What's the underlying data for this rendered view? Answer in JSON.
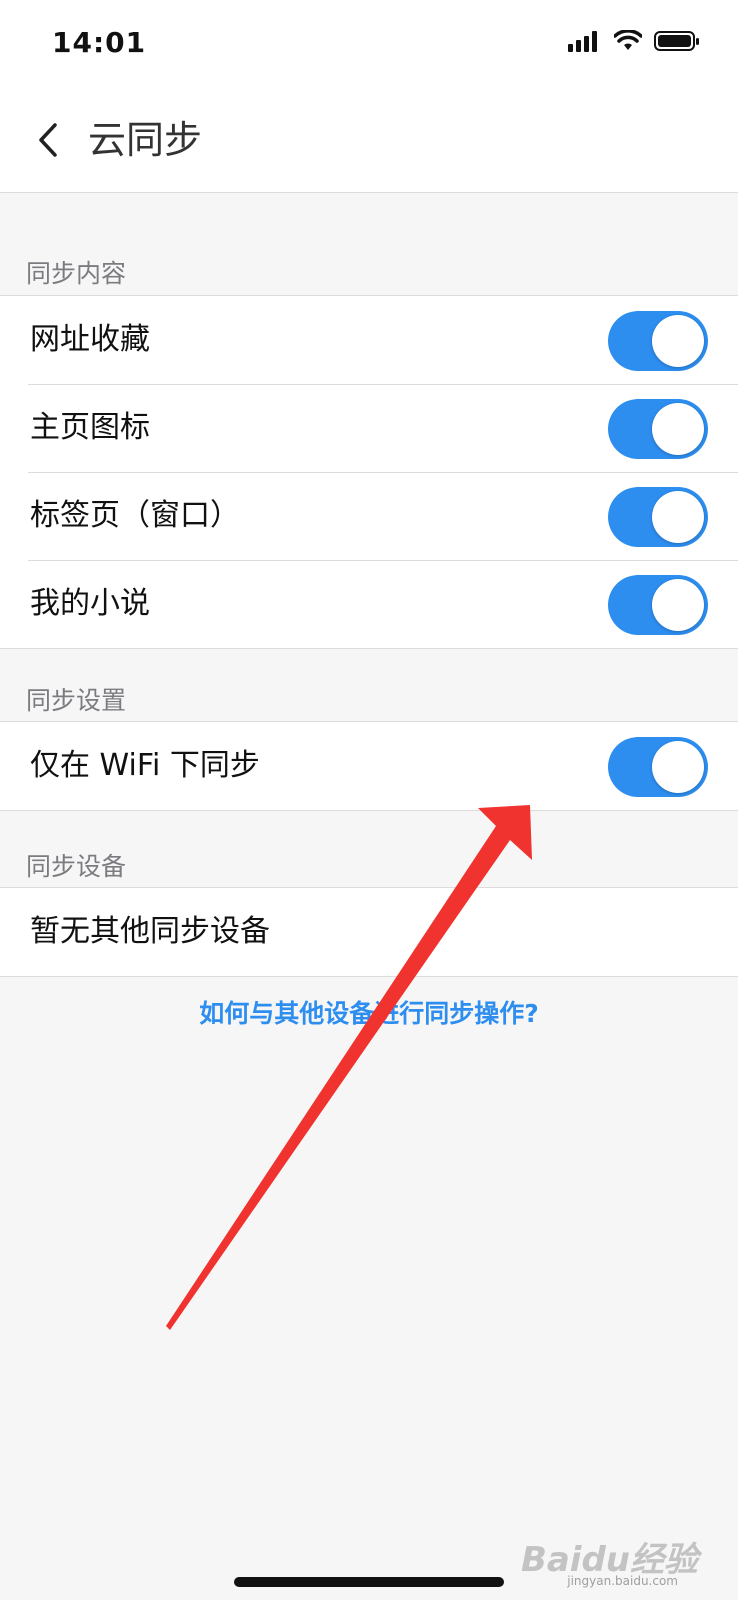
{
  "status_bar": {
    "time": "14:01"
  },
  "nav": {
    "title": "云同步",
    "back_icon": "chevron-left-icon"
  },
  "sections": {
    "content": {
      "header": "同步内容",
      "items": [
        {
          "label": "网址收藏",
          "enabled": true
        },
        {
          "label": "主页图标",
          "enabled": true
        },
        {
          "label": "标签页（窗口）",
          "enabled": true
        },
        {
          "label": "我的小说",
          "enabled": true
        }
      ]
    },
    "settings": {
      "header": "同步设置",
      "items": [
        {
          "label": "仅在 WiFi 下同步",
          "enabled": true
        }
      ]
    },
    "devices": {
      "header": "同步设备",
      "items": [
        {
          "label": "暂无其他同步设备"
        }
      ]
    }
  },
  "help_link": "如何与其他设备进行同步操作?",
  "watermark": {
    "brand": "Baidu经验",
    "url": "jingyan.baidu.com"
  },
  "colors": {
    "accent": "#2d8ef0",
    "annotation": "#f0332e"
  }
}
